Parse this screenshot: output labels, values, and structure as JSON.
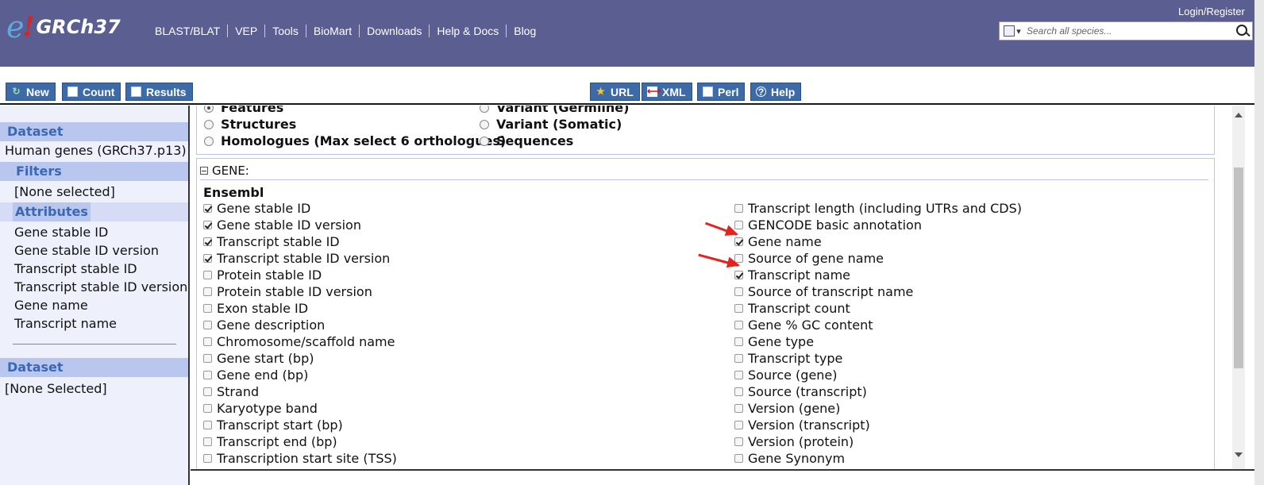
{
  "masthead": {
    "logo_e": "e",
    "logo_bang": "!",
    "logo_text": "GRCh37",
    "nav": [
      "BLAST/BLAT",
      "VEP",
      "Tools",
      "BioMart",
      "Downloads",
      "Help & Docs",
      "Blog"
    ],
    "login": "Login/Register",
    "search_placeholder": "Search all species..."
  },
  "toolbar": {
    "new": "New",
    "count": "Count",
    "results": "Results",
    "url": "URL",
    "xml": "XML",
    "perl": "Perl",
    "help": "Help"
  },
  "left_panel": {
    "dataset_head": "Dataset",
    "dataset_value": "Human genes (GRCh37.p13)",
    "filters_head": "Filters",
    "filters_value": "[None selected]",
    "attributes_head": "Attributes",
    "attributes": [
      "Gene stable ID",
      "Gene stable ID version",
      "Transcript stable ID",
      "Transcript stable ID version",
      "Gene name",
      "Transcript name"
    ],
    "dataset2_head": "Dataset",
    "dataset2_value": "[None Selected]"
  },
  "attribute_types": {
    "left": [
      {
        "label": "Features",
        "selected": true
      },
      {
        "label": "Structures",
        "selected": false
      },
      {
        "label": "Homologues (Max select 6 orthologues)",
        "selected": false
      }
    ],
    "right": [
      {
        "label": "Variant (Germline)",
        "selected": false
      },
      {
        "label": "Variant (Somatic)",
        "selected": false
      },
      {
        "label": "Sequences",
        "selected": false
      }
    ]
  },
  "gene_section": {
    "header": "GENE:",
    "group": "Ensembl",
    "left_col": [
      {
        "label": "Gene stable ID",
        "checked": true
      },
      {
        "label": "Gene stable ID version",
        "checked": true
      },
      {
        "label": "Transcript stable ID",
        "checked": true
      },
      {
        "label": "Transcript stable ID version",
        "checked": true
      },
      {
        "label": "Protein stable ID",
        "checked": false
      },
      {
        "label": "Protein stable ID version",
        "checked": false
      },
      {
        "label": "Exon stable ID",
        "checked": false
      },
      {
        "label": "Gene description",
        "checked": false
      },
      {
        "label": "Chromosome/scaffold name",
        "checked": false
      },
      {
        "label": "Gene start (bp)",
        "checked": false
      },
      {
        "label": "Gene end (bp)",
        "checked": false
      },
      {
        "label": "Strand",
        "checked": false
      },
      {
        "label": "Karyotype band",
        "checked": false
      },
      {
        "label": "Transcript start (bp)",
        "checked": false
      },
      {
        "label": "Transcript end (bp)",
        "checked": false
      },
      {
        "label": "Transcription start site (TSS)",
        "checked": false
      }
    ],
    "right_col": [
      {
        "label": "Transcript length (including UTRs and CDS)",
        "checked": false
      },
      {
        "label": "GENCODE basic annotation",
        "checked": false
      },
      {
        "label": "Gene name",
        "checked": true
      },
      {
        "label": "Source of gene name",
        "checked": false
      },
      {
        "label": "Transcript name",
        "checked": true
      },
      {
        "label": "Source of transcript name",
        "checked": false
      },
      {
        "label": "Transcript count",
        "checked": false
      },
      {
        "label": "Gene % GC content",
        "checked": false
      },
      {
        "label": "Gene type",
        "checked": false
      },
      {
        "label": "Transcript type",
        "checked": false
      },
      {
        "label": "Source (gene)",
        "checked": false
      },
      {
        "label": "Source (transcript)",
        "checked": false
      },
      {
        "label": "Version (gene)",
        "checked": false
      },
      {
        "label": "Version (transcript)",
        "checked": false
      },
      {
        "label": "Version (protein)",
        "checked": false
      },
      {
        "label": "Gene Synonym",
        "checked": false
      }
    ]
  },
  "colors": {
    "masthead": "#5b5e91",
    "button": "#3d6ba8",
    "panel_head": "#b9c6ee",
    "annotation_arrow": "#e3231c"
  }
}
